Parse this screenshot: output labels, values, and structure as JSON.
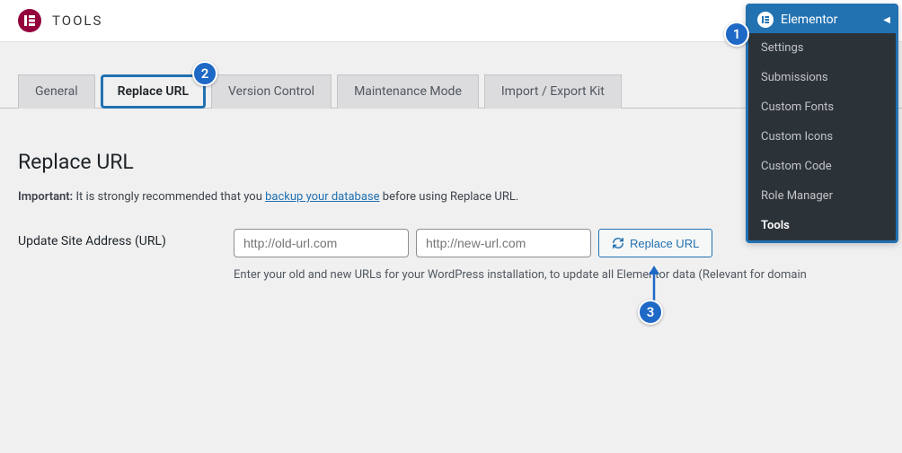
{
  "header": {
    "title": "TOOLS"
  },
  "tabs": [
    {
      "label": "General",
      "active": false
    },
    {
      "label": "Replace URL",
      "active": true,
      "highlighted": true
    },
    {
      "label": "Version Control",
      "active": false
    },
    {
      "label": "Maintenance Mode",
      "active": false
    },
    {
      "label": "Import / Export Kit",
      "active": false
    }
  ],
  "page": {
    "heading": "Replace URL",
    "important_label": "Important:",
    "notice_before": " It is strongly recommended that you ",
    "notice_link": "backup your database",
    "notice_after": " before using Replace URL.",
    "form_label": "Update Site Address (URL)",
    "old_url_placeholder": "http://old-url.com",
    "new_url_placeholder": "http://new-url.com",
    "button_label": "Replace URL",
    "help_text": "Enter your old and new URLs for your WordPress installation, to update all Elementor data (Relevant for domain"
  },
  "sidebar": {
    "title": "Elementor",
    "items": [
      {
        "label": "Settings",
        "active": false
      },
      {
        "label": "Submissions",
        "active": false
      },
      {
        "label": "Custom Fonts",
        "active": false
      },
      {
        "label": "Custom Icons",
        "active": false
      },
      {
        "label": "Custom Code",
        "active": false
      },
      {
        "label": "Role Manager",
        "active": false
      },
      {
        "label": "Tools",
        "active": true
      }
    ]
  },
  "annotations": {
    "badge1": "1",
    "badge2": "2",
    "badge3": "3"
  },
  "colors": {
    "accent": "#2271b1",
    "badge": "#1e68c6",
    "logo": "#93003c",
    "sidebar_bg": "#2c3338"
  }
}
